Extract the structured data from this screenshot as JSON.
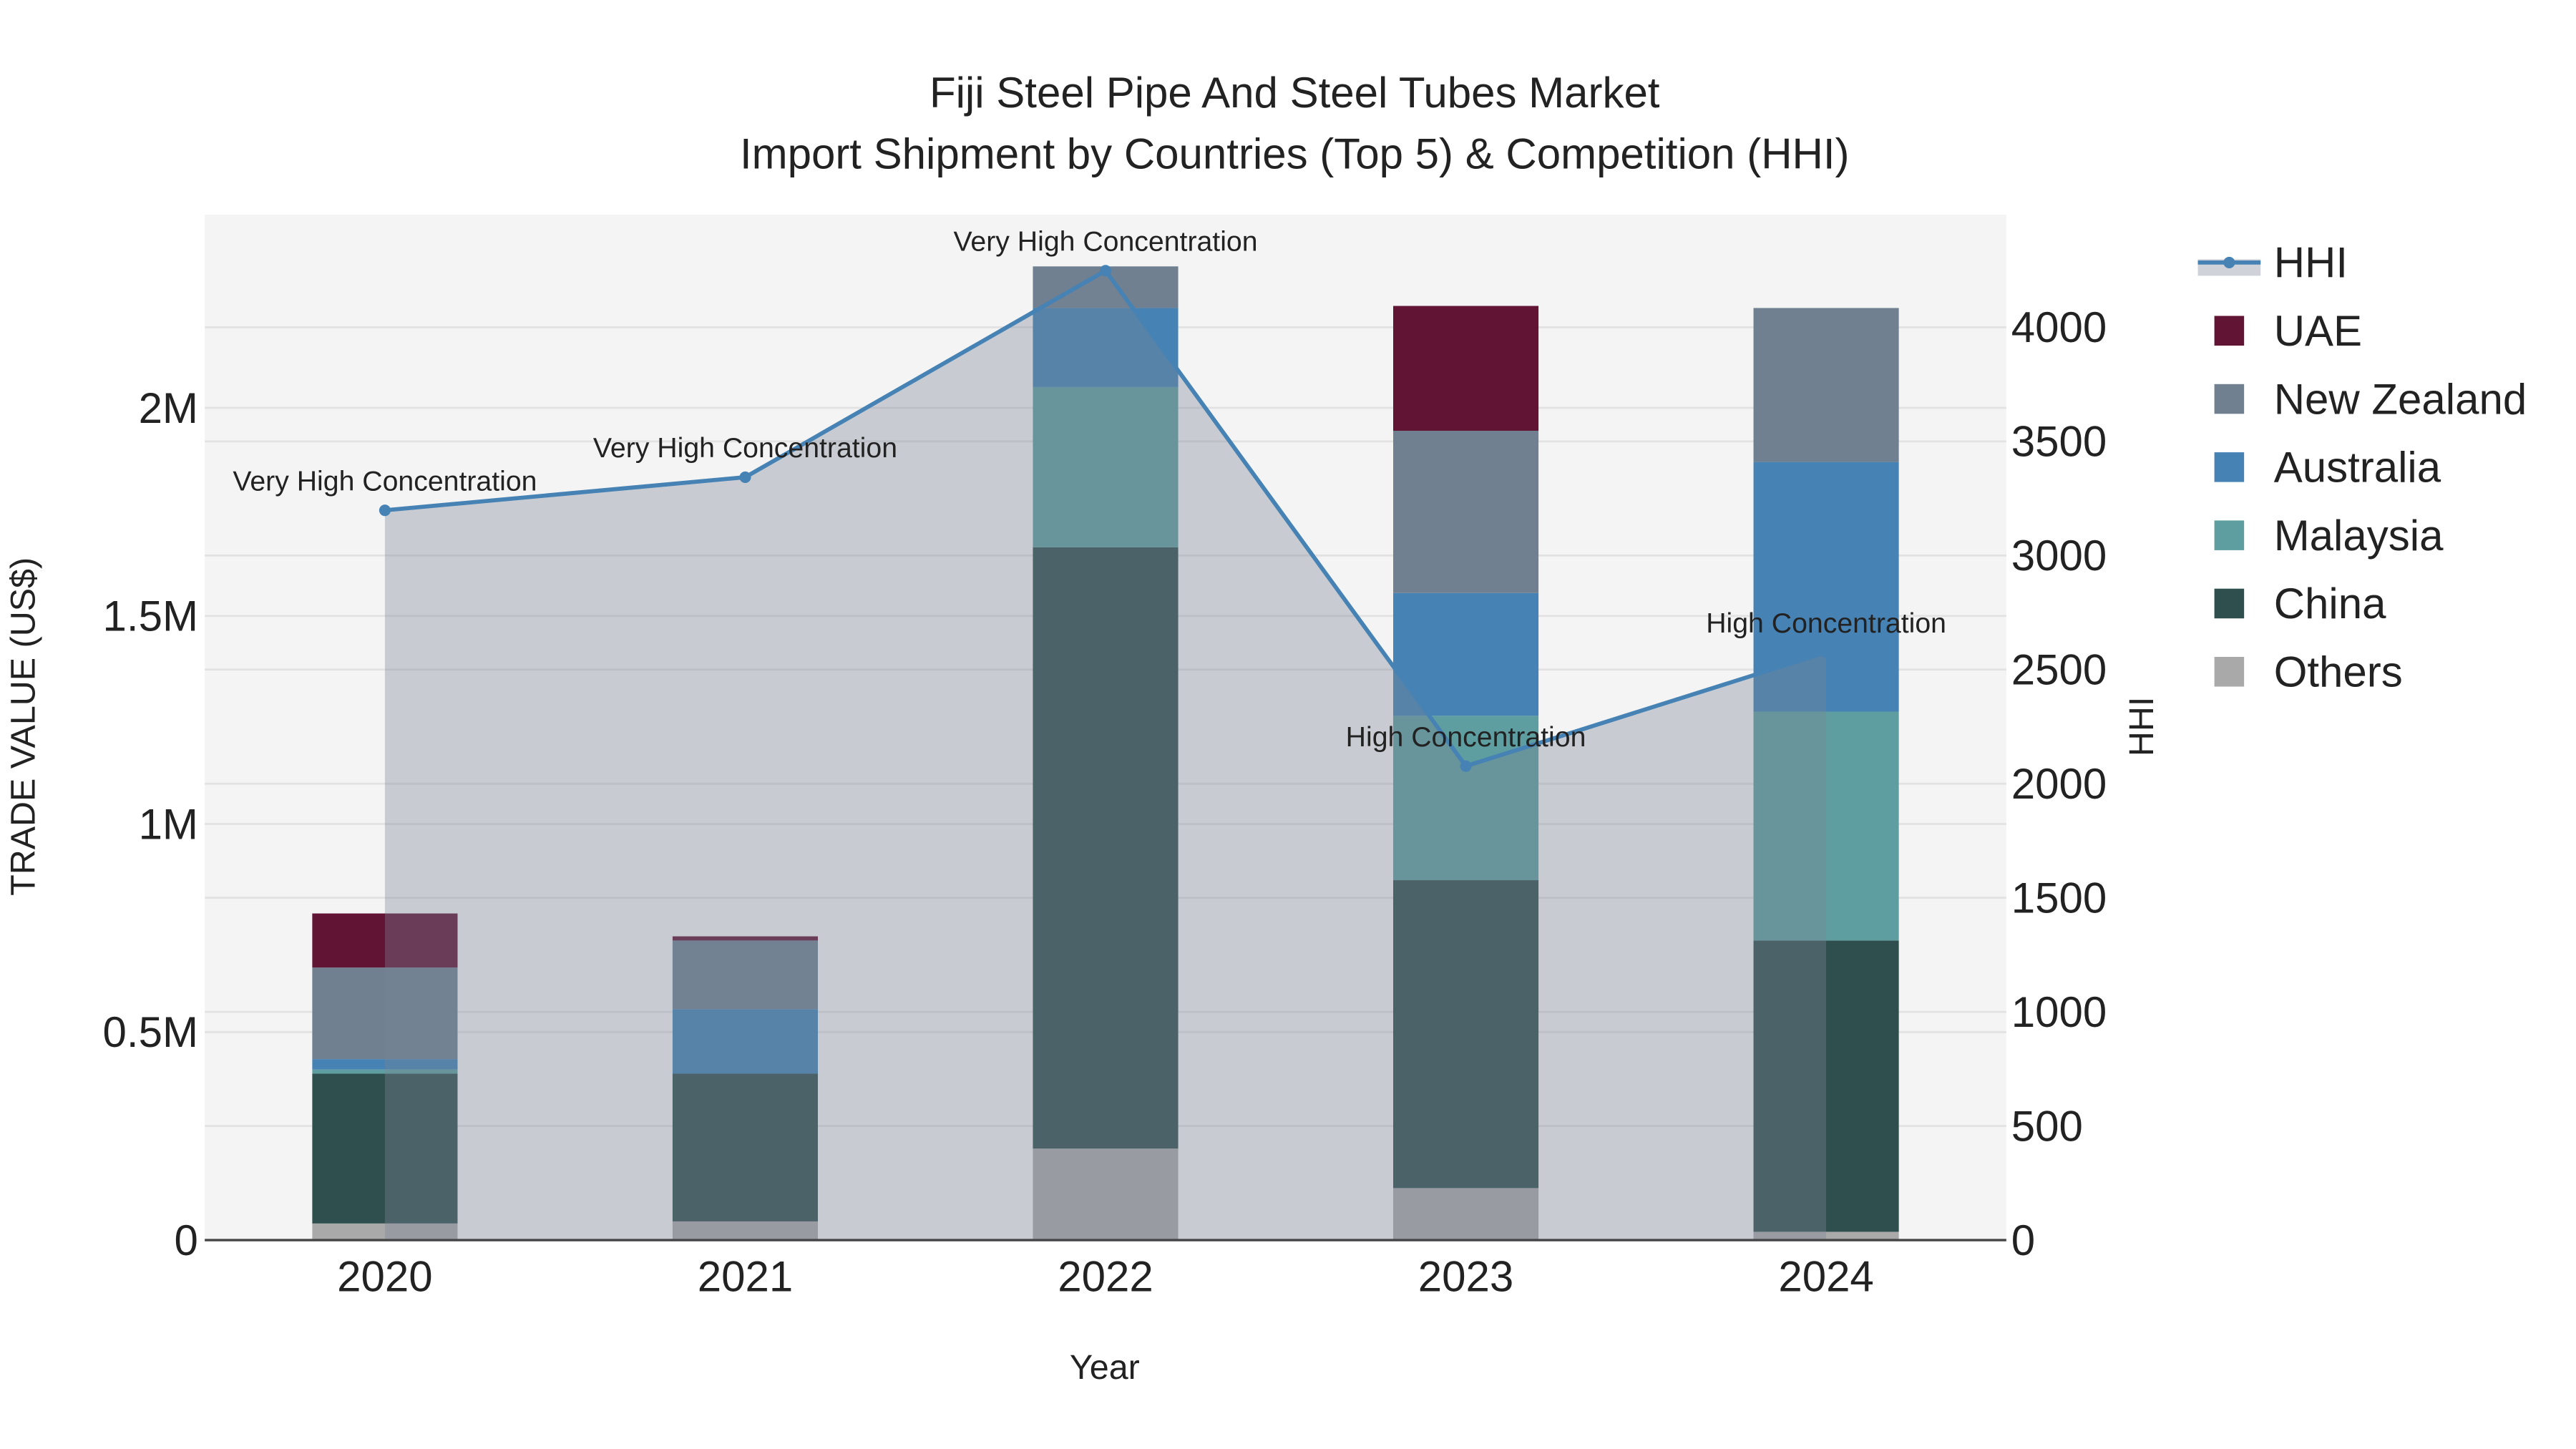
{
  "chart_data": {
    "type": "bar",
    "title_line1": "Fiji Steel Pipe And Steel Tubes Market",
    "title_line2": "Import Shipment by Countries (Top 5) & Competition (HHI)",
    "xlabel": "Year",
    "ylabel": "TRADE VALUE (US$)",
    "y2label": "HHI",
    "categories": [
      "2020",
      "2021",
      "2022",
      "2023",
      "2024"
    ],
    "ylim": [
      0,
      2470000
    ],
    "y2lim": [
      0,
      4480
    ],
    "yticks": [
      0,
      500000,
      1000000,
      1500000,
      2000000
    ],
    "ytick_labels": [
      "0",
      "0.5M",
      "1M",
      "1.5M",
      "2M"
    ],
    "y2ticks": [
      0,
      500,
      1000,
      1500,
      2000,
      2500,
      3000,
      3500,
      4000
    ],
    "y2tick_labels": [
      "0",
      "500",
      "1000",
      "1500",
      "2000",
      "2500",
      "3000",
      "3500",
      "4000"
    ],
    "stacked": true,
    "series": [
      {
        "name": "Others",
        "color": "#A9A9A9",
        "values": [
          40000,
          45000,
          220000,
          125000,
          20000
        ]
      },
      {
        "name": "China",
        "color": "#2F4F4F",
        "values": [
          360000,
          355000,
          1445000,
          740000,
          700000
        ]
      },
      {
        "name": "Malaysia",
        "color": "#5F9EA0",
        "values": [
          10000,
          0,
          385000,
          395000,
          550000
        ]
      },
      {
        "name": "Australia",
        "color": "#4682B4",
        "values": [
          25000,
          155000,
          190000,
          295000,
          600000
        ]
      },
      {
        "name": "New Zealand",
        "color": "#708090",
        "values": [
          220000,
          165000,
          100000,
          390000,
          370000
        ]
      },
      {
        "name": "UAE",
        "color": "#611434",
        "values": [
          130000,
          10000,
          0,
          300000,
          0
        ]
      }
    ],
    "hhi": {
      "name": "HHI",
      "color": "#4682B4",
      "values": [
        3198,
        3343,
        4248,
        2077,
        2576
      ],
      "annotations": [
        "Very High Concentration",
        "Very High Concentration",
        "Very High Concentration",
        "High Concentration",
        "High Concentration"
      ]
    },
    "legend": [
      "HHI",
      "UAE",
      "New Zealand",
      "Australia",
      "Malaysia",
      "China",
      "Others"
    ],
    "legend_position": "right",
    "grid": true
  }
}
